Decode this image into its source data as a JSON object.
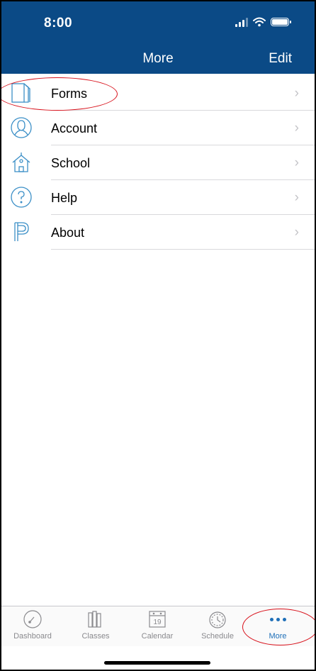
{
  "status_bar": {
    "time": "8:00"
  },
  "nav": {
    "title": "More",
    "edit_label": "Edit"
  },
  "menu": [
    {
      "label": "Forms",
      "icon": "forms-icon"
    },
    {
      "label": "Account",
      "icon": "account-icon"
    },
    {
      "label": "School",
      "icon": "school-icon"
    },
    {
      "label": "Help",
      "icon": "help-icon"
    },
    {
      "label": "About",
      "icon": "powerschool-logo-icon"
    }
  ],
  "tabs": [
    {
      "label": "Dashboard",
      "icon": "dashboard-icon"
    },
    {
      "label": "Classes",
      "icon": "classes-icon"
    },
    {
      "label": "Calendar",
      "icon": "calendar-icon",
      "day": "19"
    },
    {
      "label": "Schedule",
      "icon": "schedule-icon"
    },
    {
      "label": "More",
      "icon": "more-icon",
      "active": true
    }
  ],
  "colors": {
    "header": "#0b4a86",
    "accent": "#1e6fb8",
    "icon": "#3b8fc7",
    "annotation": "#d8101a"
  }
}
